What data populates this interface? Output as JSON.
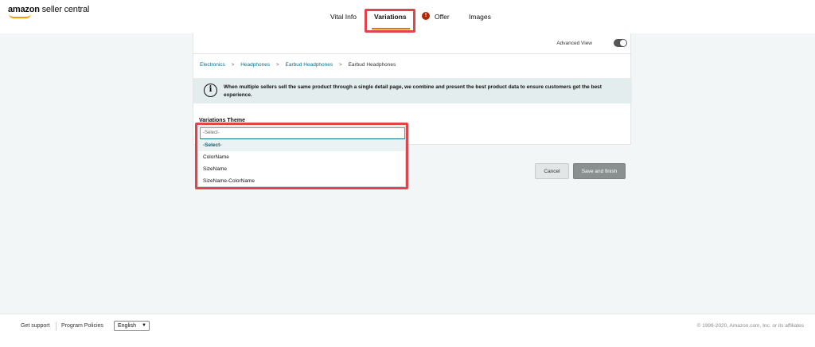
{
  "header": {
    "logo_word1": "amazon",
    "logo_word2": " seller central",
    "tabs": [
      {
        "label": "Vital Info"
      },
      {
        "label": "Variations"
      },
      {
        "label": "Offer"
      },
      {
        "label": "Images"
      }
    ],
    "offer_alert_symbol": "!",
    "active_tab": "Variations",
    "accent_color": "#e77600",
    "alert_color": "#b12704",
    "highlight_color": "#e0454b"
  },
  "panel": {
    "advanced_view_label": "Advanced View",
    "advanced_view_on": true,
    "breadcrumb": [
      "Electronics",
      "Headphones",
      "Earbud Headphones",
      "Earbud Headphones"
    ],
    "breadcrumb_separator": ">",
    "notice_icon": "info-icon",
    "notice_text": "When multiple sellers sell the same product through a single detail page, we combine and present the best product data to ensure customers get the best experience.",
    "variations_theme_label": "Variations Theme",
    "dropdown": {
      "placeholder": "-Select-",
      "options": [
        "-Select-",
        "ColorName",
        "SizeName",
        "SizeName-ColorName"
      ],
      "highlighted_option": "-Select-"
    }
  },
  "actions": {
    "cancel_label": "Cancel",
    "save_label": "Save and finish"
  },
  "footer": {
    "get_support": "Get support",
    "program_policies": "Program Policies",
    "language": "English",
    "copyright": "© 1999-2020, Amazon.com, Inc. or its affiliates"
  }
}
